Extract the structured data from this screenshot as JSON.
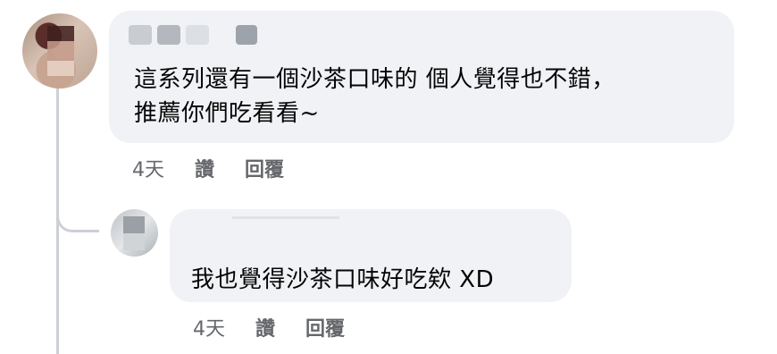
{
  "comment": {
    "text": "這系列還有一個沙茶口味的 個人覺得也不錯，\n推薦你們吃看看~",
    "time": "4天",
    "like_label": "讚",
    "reply_label": "回覆"
  },
  "reply": {
    "text": "我也覺得沙茶口味好吃欸 XD",
    "time": "4天",
    "like_label": "讚",
    "reply_label": "回覆"
  },
  "colors": {
    "bubble_bg": "#f0f2f5",
    "meta_text": "#65676b",
    "thread_line": "#ccd0d5"
  }
}
